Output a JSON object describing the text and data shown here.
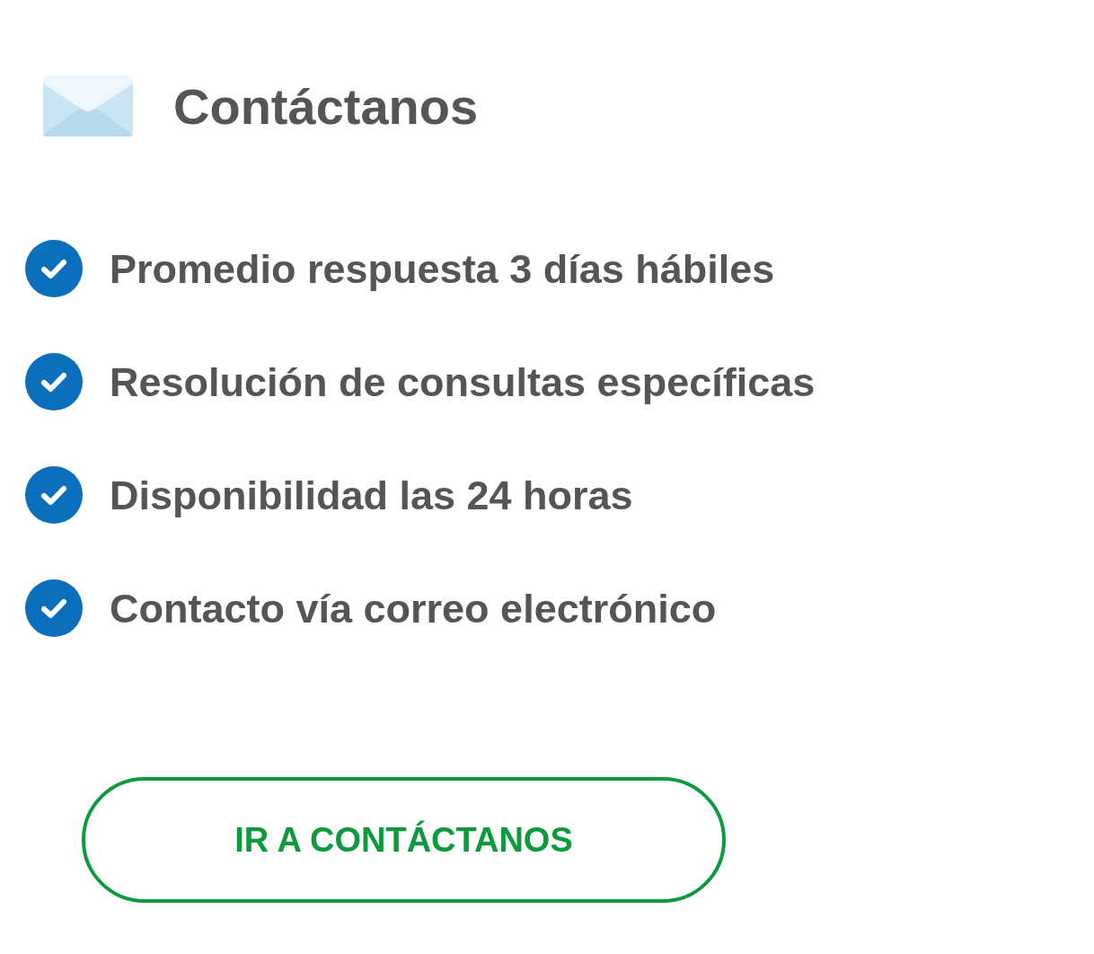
{
  "header": {
    "title": "Contáctanos"
  },
  "features": [
    {
      "text": "Promedio respuesta 3 días hábiles"
    },
    {
      "text": "Resolución de consultas específicas"
    },
    {
      "text": "Disponibilidad las 24 horas"
    },
    {
      "text": "Contacto vía correo electrónico"
    }
  ],
  "button": {
    "label": "IR A CONTÁCTANOS"
  }
}
